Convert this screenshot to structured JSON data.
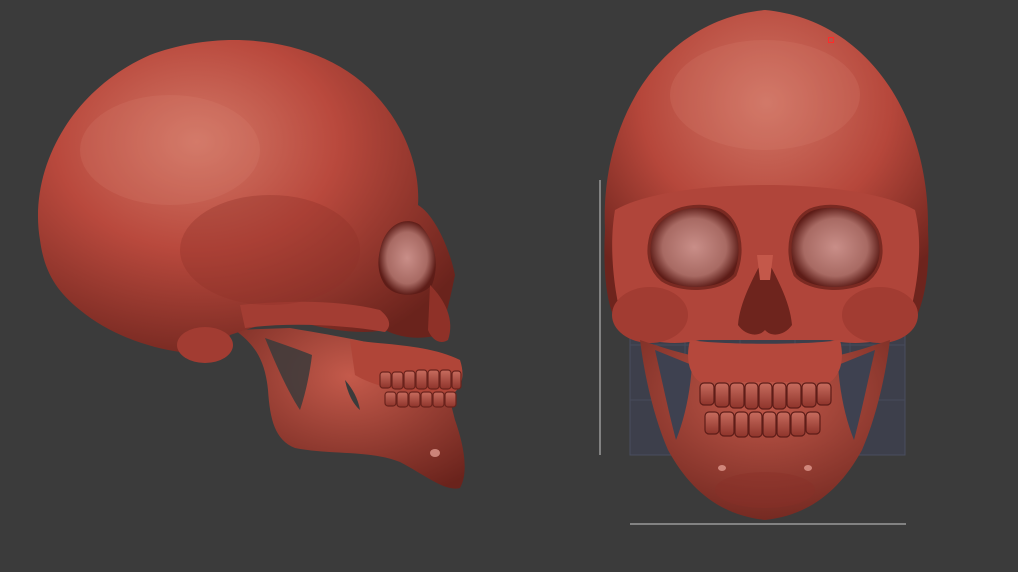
{
  "viewport": {
    "background_color": "#3b3b3b",
    "material_color": "#b5463c",
    "material_highlight": "#cf6a5c",
    "material_shadow": "#5e1d18",
    "guide_color": "#c8c8c8",
    "floor_grid_color": "#4a4f63",
    "cursor_color": "#ff2a2a"
  },
  "models": [
    {
      "name": "skull-side-view"
    },
    {
      "name": "skull-front-view"
    }
  ]
}
